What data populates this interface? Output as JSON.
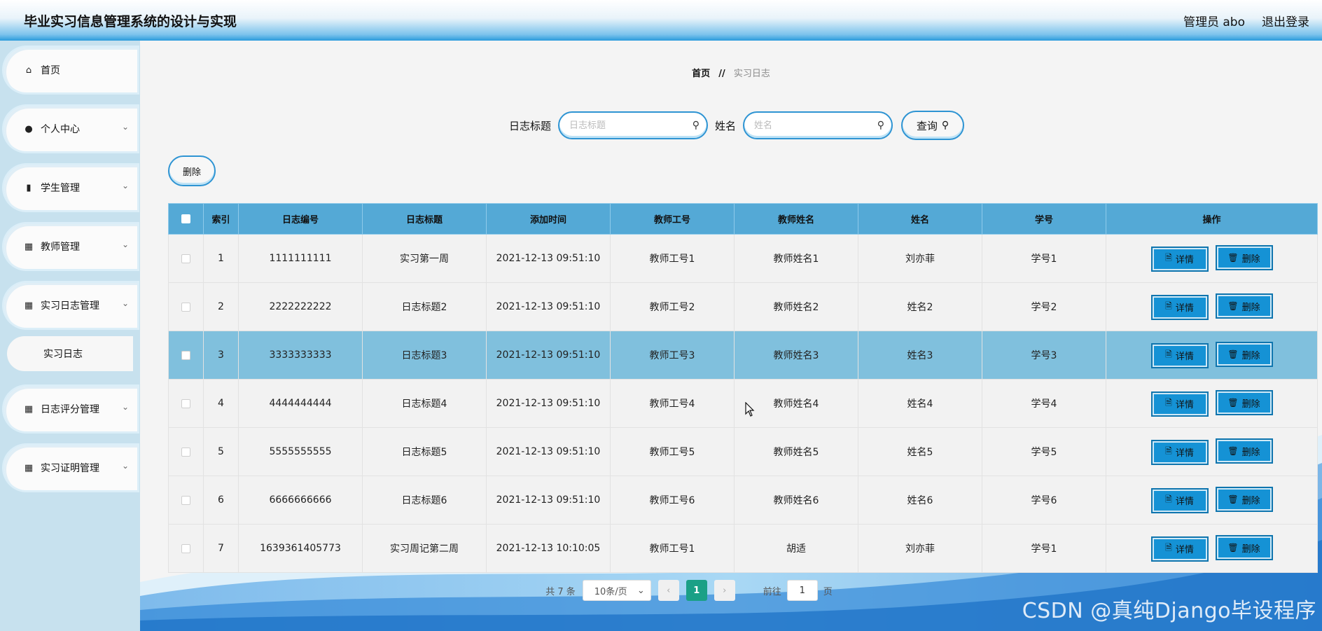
{
  "header": {
    "title": "毕业实习信息管理系统的设计与实现",
    "user_label": "管理员 abo",
    "logout": "退出登录"
  },
  "sidebar": {
    "items": [
      {
        "label": "首页",
        "icon": "home-icon",
        "expandable": false
      },
      {
        "label": "个人中心",
        "icon": "user-icon",
        "expandable": true
      },
      {
        "label": "学生管理",
        "icon": "bar-chart-icon",
        "expandable": true
      },
      {
        "label": "教师管理",
        "icon": "grid-icon",
        "expandable": true
      },
      {
        "label": "实习日志管理",
        "icon": "grid-icon",
        "expandable": true
      },
      {
        "label": "日志评分管理",
        "icon": "grid-icon",
        "expandable": true
      },
      {
        "label": "实习证明管理",
        "icon": "grid-icon",
        "expandable": true
      }
    ],
    "submenu": {
      "label": "实习日志"
    }
  },
  "breadcrumb": {
    "home": "首页",
    "sep": "//",
    "current": "实习日志"
  },
  "search": {
    "title_label": "日志标题",
    "title_placeholder": "日志标题",
    "name_label": "姓名",
    "name_placeholder": "姓名",
    "query_label": "查询"
  },
  "toolbar": {
    "delete_label": "删除"
  },
  "table": {
    "columns": [
      "索引",
      "日志编号",
      "日志标题",
      "添加时间",
      "教师工号",
      "教师姓名",
      "姓名",
      "学号",
      "操作"
    ],
    "detail_label": "详情",
    "delete_label": "删除",
    "rows": [
      {
        "index": "1",
        "log_no": "1111111111",
        "title": "实习第一周",
        "time": "2021-12-13 09:51:10",
        "teacher_no": "教师工号1",
        "teacher_name": "教师姓名1",
        "name": "刘亦菲",
        "student_no": "学号1"
      },
      {
        "index": "2",
        "log_no": "2222222222",
        "title": "日志标题2",
        "time": "2021-12-13 09:51:10",
        "teacher_no": "教师工号2",
        "teacher_name": "教师姓名2",
        "name": "姓名2",
        "student_no": "学号2"
      },
      {
        "index": "3",
        "log_no": "3333333333",
        "title": "日志标题3",
        "time": "2021-12-13 09:51:10",
        "teacher_no": "教师工号3",
        "teacher_name": "教师姓名3",
        "name": "姓名3",
        "student_no": "学号3"
      },
      {
        "index": "4",
        "log_no": "4444444444",
        "title": "日志标题4",
        "time": "2021-12-13 09:51:10",
        "teacher_no": "教师工号4",
        "teacher_name": "教师姓名4",
        "name": "姓名4",
        "student_no": "学号4"
      },
      {
        "index": "5",
        "log_no": "5555555555",
        "title": "日志标题5",
        "time": "2021-12-13 09:51:10",
        "teacher_no": "教师工号5",
        "teacher_name": "教师姓名5",
        "name": "姓名5",
        "student_no": "学号5"
      },
      {
        "index": "6",
        "log_no": "6666666666",
        "title": "日志标题6",
        "time": "2021-12-13 09:51:10",
        "teacher_no": "教师工号6",
        "teacher_name": "教师姓名6",
        "name": "姓名6",
        "student_no": "学号6"
      },
      {
        "index": "7",
        "log_no": "1639361405773",
        "title": "实习周记第二周",
        "time": "2021-12-13 10:10:05",
        "teacher_no": "教师工号1",
        "teacher_name": "胡适",
        "name": "刘亦菲",
        "student_no": "学号1"
      }
    ]
  },
  "pagination": {
    "total": "共 7 条",
    "page_size": "10条/页",
    "current_page": "1",
    "goto_label": "前往",
    "goto_value": "1",
    "page_unit": "页"
  },
  "watermark": "CSDN @真纯Django毕设程序",
  "colors": {
    "header_accent": "#2a9bdc",
    "table_header": "#54a9d6",
    "action_button": "#1592d5",
    "highlight_row": "#80c0dd",
    "active_page": "#1aa086"
  }
}
